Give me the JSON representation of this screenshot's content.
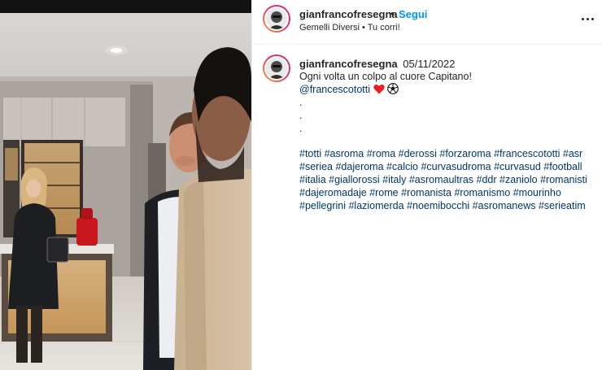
{
  "header": {
    "username": "gianfrancofresegna",
    "separator": "•",
    "follow_label": "Segui",
    "subline": "Gemelli Diversi • Tu corri!",
    "more_icon": "more-options-icon"
  },
  "caption": {
    "username": "gianfrancofresegna",
    "date": "05/11/2022",
    "lines": [
      "Ogni volta un colpo al cuore Capitano!",
      "@francescototti",
      ".",
      ".",
      "."
    ],
    "mention": "@francescototti",
    "emoji_icons": [
      "heart-icon",
      "soccer-ball-icon"
    ],
    "hashtag_lines": [
      [
        "#totti",
        "#asroma",
        "#roma",
        "#derossi",
        "#forzaroma",
        "#francescototti",
        "#asr"
      ],
      [
        "#seriea",
        "#dajeroma",
        "#calcio",
        "#curvasudroma",
        "#curvasud",
        "#football"
      ],
      [
        "#italia",
        "#giallorossi",
        "#italy",
        "#asromaultras",
        "#ddr",
        "#zaniolo",
        "#romanisti"
      ],
      [
        "#dajeromadaje",
        "#rome",
        "#romanista",
        "#romanismo",
        "#mourinho"
      ],
      [
        "#pellegrini",
        "#laziomerda",
        "#noemibocchi",
        "#asromanews",
        "#serieatim"
      ]
    ]
  },
  "colors": {
    "link": "#00376b",
    "follow": "#0095f6",
    "text": "#262626",
    "heart": "#ed1c24"
  }
}
